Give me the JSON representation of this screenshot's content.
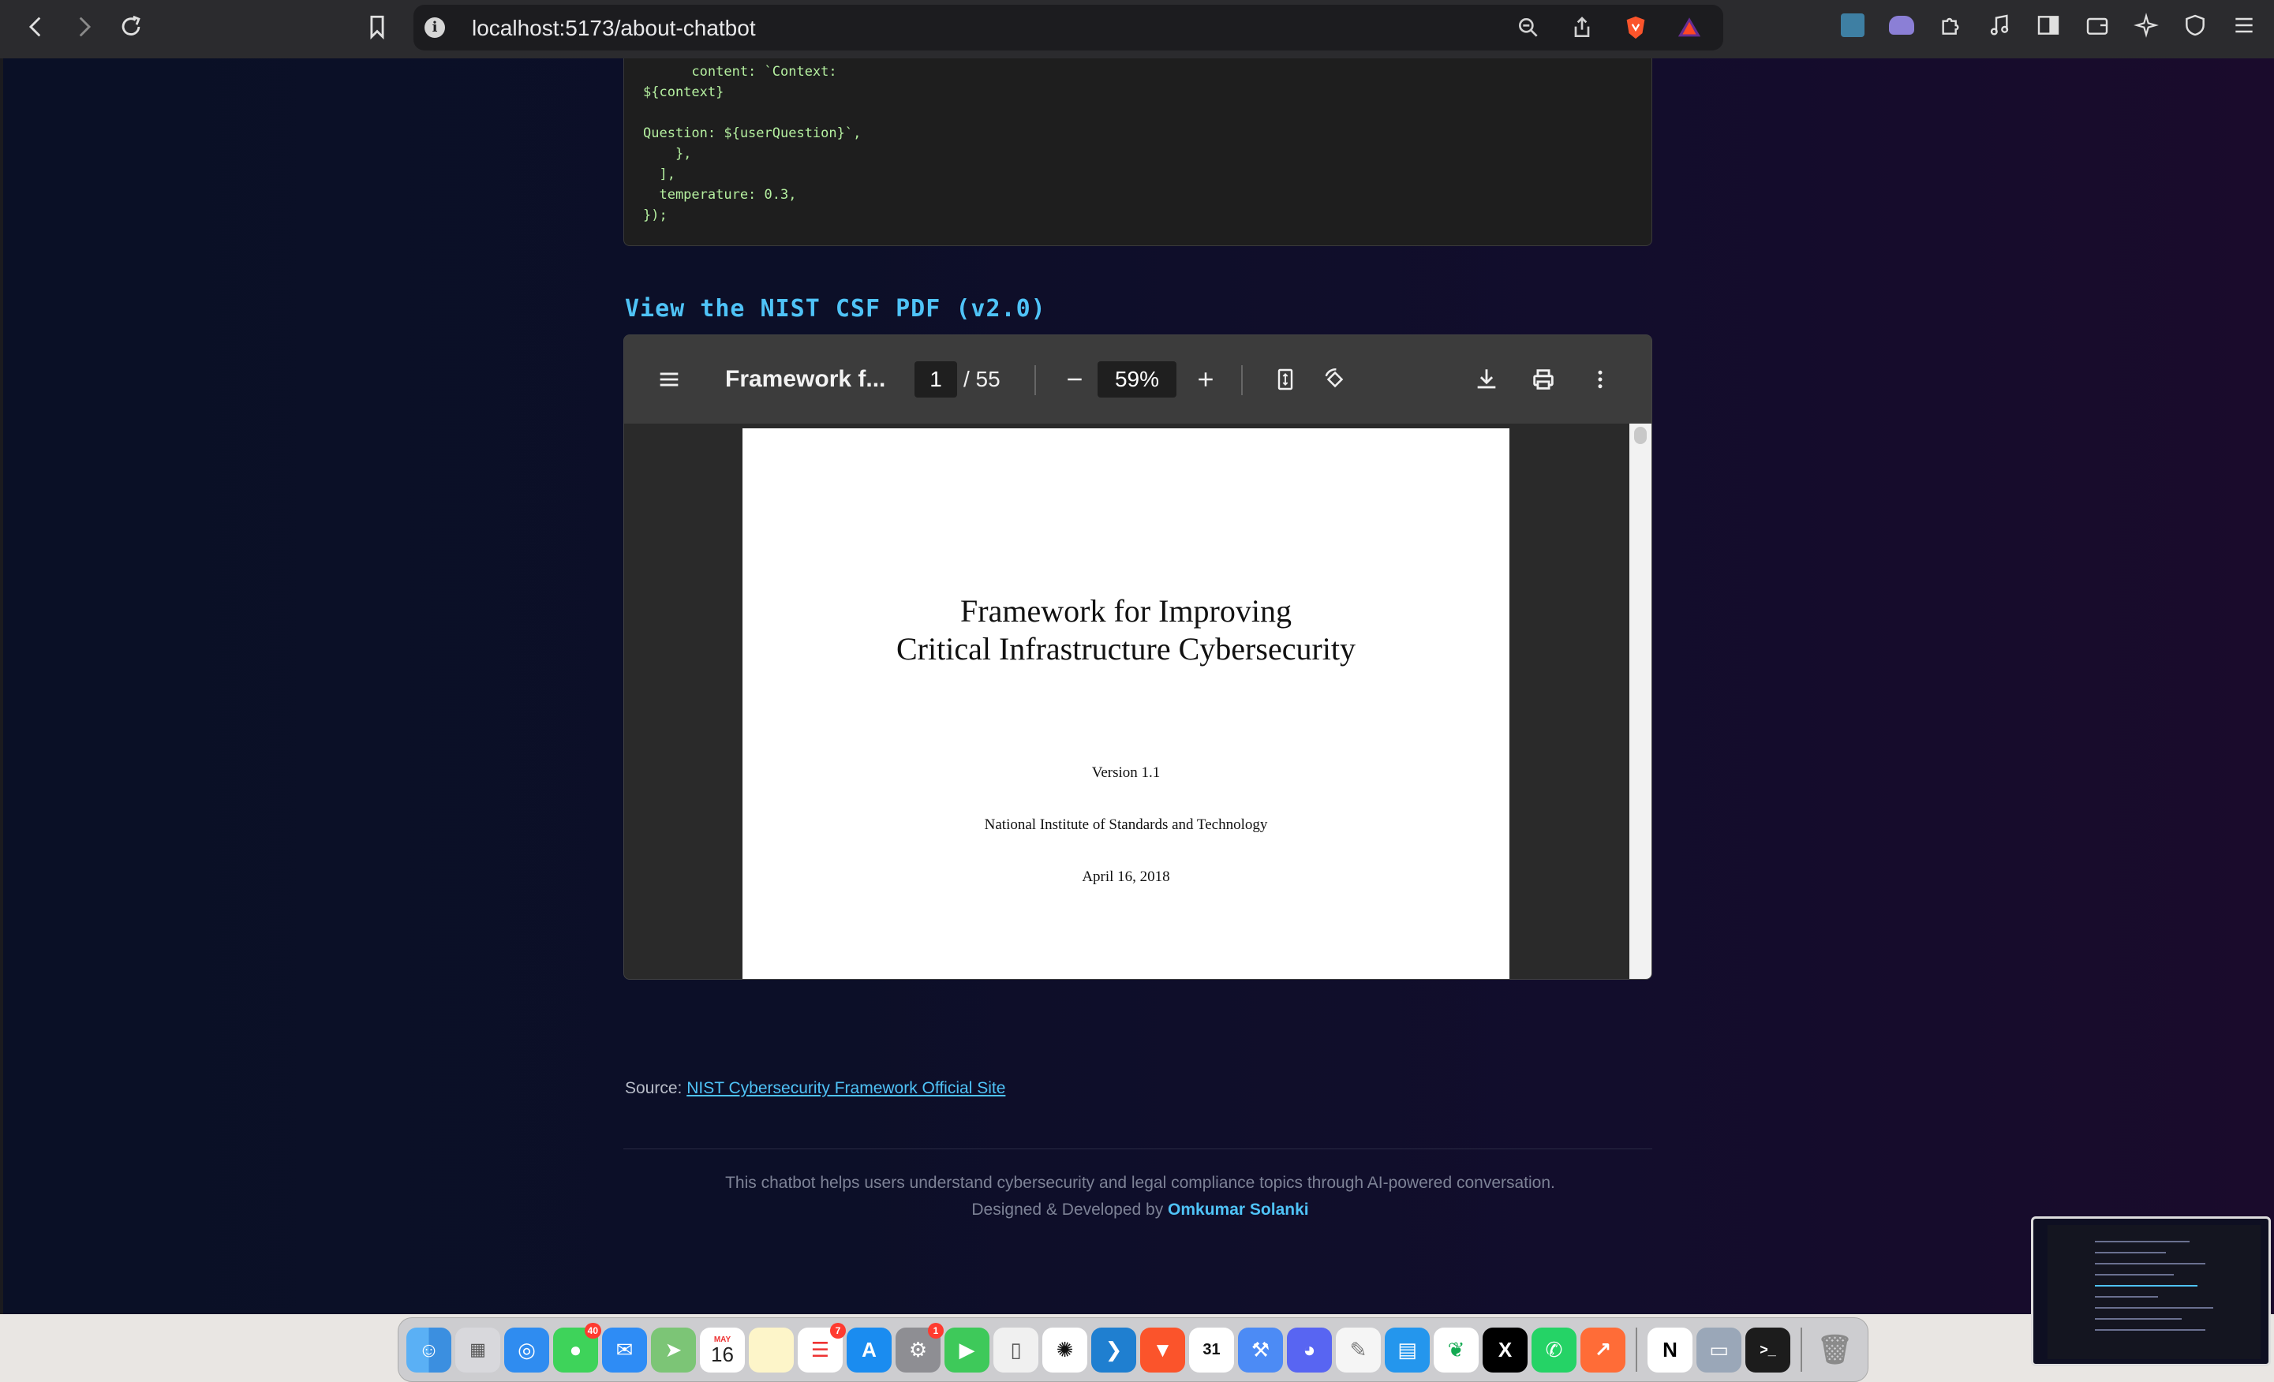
{
  "browser": {
    "url": "localhost:5173/about-chatbot"
  },
  "code": {
    "lines": [
      "      content: `Context:",
      "${context}",
      "",
      "Question: ${userQuestion}`,",
      "    },",
      "  ],",
      "  temperature: 0.3,",
      "});"
    ]
  },
  "pdf_section": {
    "heading": "View the NIST CSF PDF (v2.0)"
  },
  "viewer": {
    "title": "Framework f...",
    "current_page": "1",
    "page_total": "/ 55",
    "zoom": "59%",
    "document": {
      "title_line1": "Framework for Improving",
      "title_line2": "Critical Infrastructure Cybersecurity",
      "version": "Version 1.1",
      "organization": "National Institute of Standards and Technology",
      "date": "April 16, 2018"
    }
  },
  "source": {
    "label": "Source:",
    "link_text": "NIST Cybersecurity Framework Official Site"
  },
  "footer": {
    "description": "This chatbot helps users understand cybersecurity and legal compliance topics through AI-powered conversation.",
    "designed_by": "Designed & Developed by",
    "author": "Omkumar Solanki"
  },
  "dock": {
    "messages_badge": "40",
    "calendar_month": "MAY",
    "calendar_day": "16",
    "reminders_badge": "7",
    "settings_badge": "1",
    "gcal_day": "31"
  },
  "colors": {
    "accent": "#4fc3f7",
    "code_text": "#b5f0a0",
    "page_bg_start": "#0a1026",
    "page_bg_end": "#1a0b2c"
  }
}
